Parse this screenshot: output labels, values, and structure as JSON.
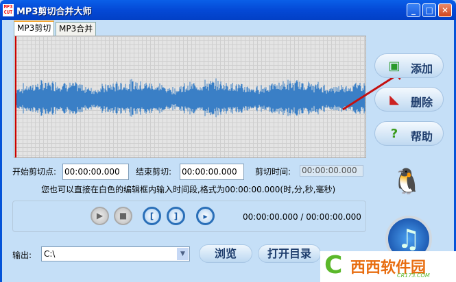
{
  "window": {
    "title": "MP3剪切合并大师",
    "icon_text": "MP3 CUT",
    "controls": [
      "minimize",
      "maximize",
      "close"
    ]
  },
  "tabs": [
    {
      "label": "MP3剪切",
      "active": true
    },
    {
      "label": "MP3合并",
      "active": false
    }
  ],
  "waveform": {
    "color": "#3a7fc6",
    "background": "#e4e4e4",
    "cursor_color": "#cc0000"
  },
  "cut": {
    "start_label": "开始剪切点:",
    "start_value": "00:00:00.000",
    "end_label": "结束剪切:",
    "end_value": "00:00:00.000",
    "duration_label": "剪切时间:",
    "duration_value": "00:00:00.000"
  },
  "hint": "您也可以直接在白色的编辑框内输入时间段,格式为00:00:00.000(时,分,秒,毫秒)",
  "player": {
    "buttons": [
      "play",
      "stop",
      "mark-start",
      "mark-end",
      "preview-cut"
    ],
    "time": "00:00:00.000 / 00:00:00.000"
  },
  "output": {
    "label": "输出:",
    "value": "C:\\",
    "browse": "浏览",
    "open_dir": "打开目录"
  },
  "side": {
    "add": "添加",
    "delete": "删除",
    "help": "帮助"
  },
  "watermark": {
    "text": "西西软件园",
    "url": "CR173.COM"
  }
}
